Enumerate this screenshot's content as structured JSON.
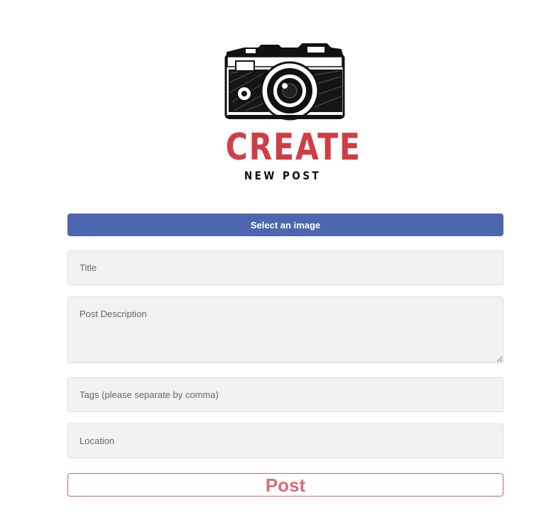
{
  "logo": {
    "title": "CREATE",
    "subtitle": "NEW POST",
    "icon": "camera-icon",
    "title_color": "#d13d44"
  },
  "form": {
    "select_image_label": "Select an image",
    "title_placeholder": "Title",
    "description_placeholder": "Post Description",
    "tags_placeholder": "Tags (please separate by comma)",
    "location_placeholder": "Location",
    "post_label": "Post"
  },
  "colors": {
    "accent_blue": "#4d66b0",
    "post_red": "#df6b76",
    "field_bg": "#f2f2f2"
  }
}
